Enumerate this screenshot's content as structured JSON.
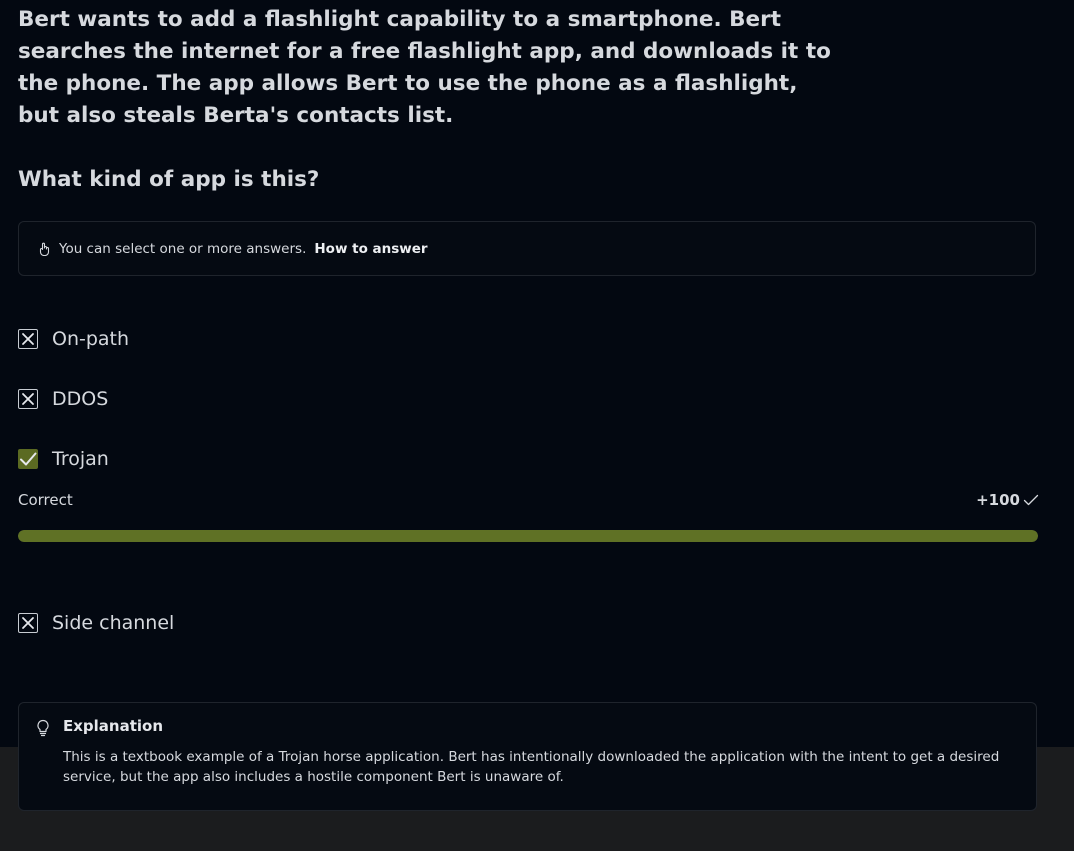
{
  "question": {
    "text": "Bert wants to add a flashlight capability to a smartphone. Bert searches the internet for a free flashlight app, and downloads it to the phone. The app allows Bert to use the phone as a flashlight, but also steals Berta's contacts list.",
    "prompt": "What kind of app is this?"
  },
  "hint": {
    "icon": "hand-pointer-icon",
    "text": "You can select one or more answers.",
    "link": "How to answer"
  },
  "options": [
    {
      "label": "On-path",
      "state": "incorrect",
      "icon": "x-icon"
    },
    {
      "label": "DDOS",
      "state": "incorrect",
      "icon": "x-icon"
    },
    {
      "label": "Trojan",
      "state": "correct",
      "icon": "check-icon"
    },
    {
      "label": "Side channel",
      "state": "incorrect",
      "icon": "x-icon"
    }
  ],
  "result": {
    "label": "Correct",
    "score": "+100",
    "progress_percent": 100
  },
  "explanation": {
    "icon": "lightbulb-icon",
    "title": "Explanation",
    "text": "This is a textbook example of a Trojan horse application. Bert has intentionally downloaded the application with the intent to get a desired service, but the app also includes a hostile component Bert is unaware of."
  },
  "colors": {
    "background": "#030811",
    "correct_accent": "#5f7125",
    "bottom_strip": "#1b1c1e"
  }
}
